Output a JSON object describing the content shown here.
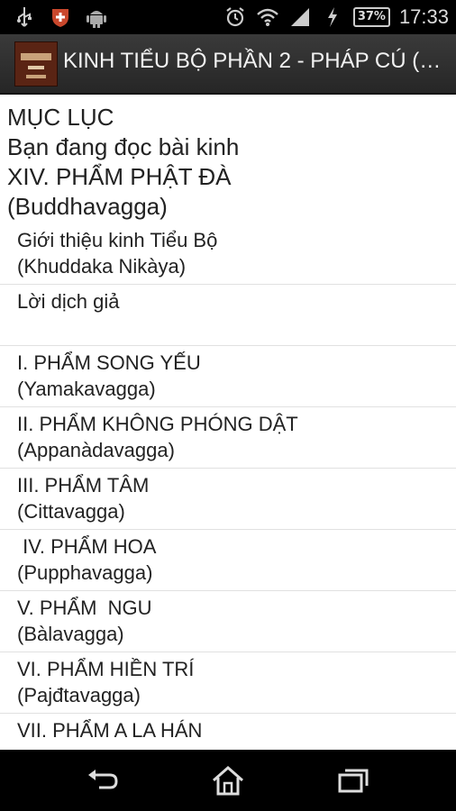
{
  "status_bar": {
    "time": "17:33",
    "battery": "37%",
    "icons": [
      "usb-icon",
      "app-shield-icon",
      "android-icon",
      "alarm-icon",
      "wifi-icon",
      "signal-icon",
      "charging-icon"
    ]
  },
  "action_bar": {
    "title": "KINH TIỂU BỘ PHẦN 2 - PHÁP CÚ (…"
  },
  "header": {
    "line1": "MỤC LỤC",
    "line2": "Bạn đang đọc bài kinh",
    "line3": "XIV. PHẨM PHẬT ĐÀ",
    "line4": "(Buddhavagga)"
  },
  "list": [
    {
      "line1": "Giới thiệu kinh Tiểu Bộ",
      "line2": "(Khuddaka Nikàya)"
    },
    {
      "line1": "Lời dịch giả",
      "line2": ""
    },
    {
      "line1": "I. PHẨM SONG YẾU",
      "line2": "(Yamakavagga)"
    },
    {
      "line1": "II.  PHẨM KHÔNG PHÓNG DẬT",
      "line2": "(Appanàdavagga)"
    },
    {
      "line1": "III.  PHẨM TÂM",
      "line2": "(Cittavagga)"
    },
    {
      "line1": " IV. PHẨM HOA",
      "line2": "(Pupphavagga)"
    },
    {
      "line1": "V. PHẨM  NGU",
      "line2": "(Bàlavagga)"
    },
    {
      "line1": "VI. PHẨM HIỀN TRÍ",
      "line2": "(Pajđtavagga)"
    },
    {
      "line1": "VII. PHẨM A LA HÁN",
      "line2": ""
    }
  ],
  "nav_bar": {
    "buttons": [
      "back-icon",
      "home-icon",
      "recents-icon"
    ]
  }
}
